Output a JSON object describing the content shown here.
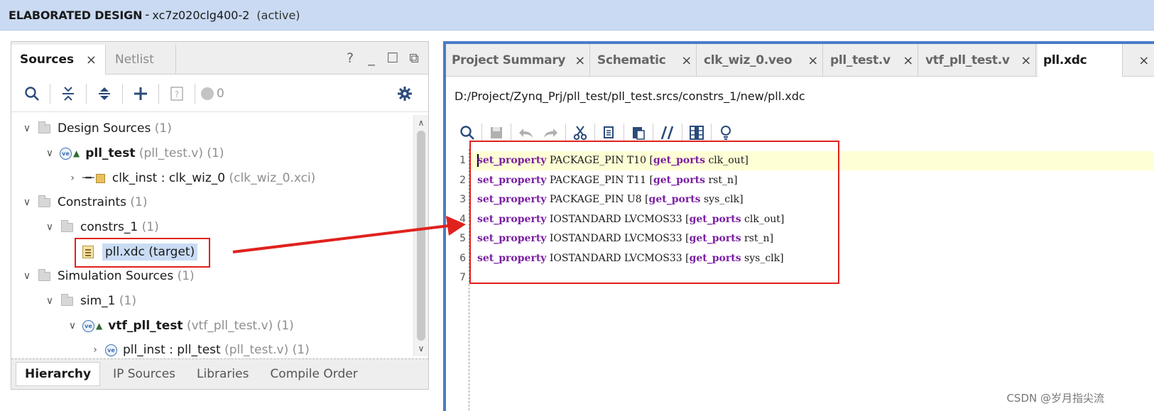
{
  "header": {
    "title": "ELABORATED DESIGN",
    "separator": "-",
    "part": "xc7z020clg400-2",
    "state": "(active)"
  },
  "sources_panel": {
    "tabs": [
      {
        "label": "Sources",
        "close": "×"
      },
      {
        "label": "Netlist"
      }
    ],
    "window_controls": [
      "?",
      "_",
      "☐",
      "⧉"
    ],
    "toolbar": {
      "count": "0",
      "icons": [
        "search-icon",
        "collapse-all-icon",
        "expand-all-icon",
        "add-icon",
        "properties-icon",
        "status-dot-icon",
        "gear-icon"
      ]
    },
    "tree": [
      {
        "label": "Design Sources",
        "count": "(1)"
      },
      {
        "label": "pll_test",
        "file": "(pll_test.v)",
        "count": "(1)"
      },
      {
        "label": "clk_inst : clk_wiz_0",
        "file": "(clk_wiz_0.xci)"
      },
      {
        "label": "Constraints",
        "count": "(1)"
      },
      {
        "label": "constrs_1",
        "count": "(1)"
      },
      {
        "label": "pll.xdc (target)"
      },
      {
        "label": "Simulation Sources",
        "count": "(1)"
      },
      {
        "label": "sim_1",
        "count": "(1)"
      },
      {
        "label": "vtf_pll_test",
        "file": "(vtf_pll_test.v)",
        "count": "(1)"
      },
      {
        "label": "pll_inst : pll_test",
        "file": "(pll_test.v)",
        "count": "(1)"
      }
    ],
    "bottom_tabs": [
      "Hierarchy",
      "IP Sources",
      "Libraries",
      "Compile Order"
    ]
  },
  "editor": {
    "tabs": [
      {
        "label": "Project Summary",
        "close": "×"
      },
      {
        "label": "Schematic",
        "close": "×"
      },
      {
        "label": "clk_wiz_0.veo",
        "close": "×"
      },
      {
        "label": "pll_test.v",
        "close": "×"
      },
      {
        "label": "vtf_pll_test.v",
        "close": "×"
      },
      {
        "label": "pll.xdc",
        "close": "×"
      }
    ],
    "file_path": "D:/Project/Zynq_Prj/pll_test/pll_test.srcs/constrs_1/new/pll.xdc",
    "line_numbers": [
      "1",
      "2",
      "3",
      "4",
      "5",
      "6",
      "7"
    ],
    "lines": [
      {
        "cmd": "set_property",
        "args": "PACKAGE_PIN T10",
        "open": "[",
        "sub": "get_ports",
        "port": "clk_out",
        "close": "]"
      },
      {
        "cmd": "set_property",
        "args": "PACKAGE_PIN T11",
        "open": "[",
        "sub": "get_ports",
        "port": "rst_n",
        "close": "]"
      },
      {
        "cmd": "set_property",
        "args": "PACKAGE_PIN U8",
        "open": "[",
        "sub": "get_ports",
        "port": "sys_clk",
        "close": "]"
      },
      {
        "cmd": "set_property",
        "args": "IOSTANDARD LVCMOS33",
        "open": "[",
        "sub": "get_ports",
        "port": "clk_out",
        "close": "]"
      },
      {
        "cmd": "set_property",
        "args": "IOSTANDARD LVCMOS33",
        "open": "[",
        "sub": "get_ports",
        "port": "rst_n",
        "close": "]"
      },
      {
        "cmd": "set_property",
        "args": "IOSTANDARD LVCMOS33",
        "open": "[",
        "sub": "get_ports",
        "port": "sys_clk",
        "close": "]"
      }
    ]
  },
  "watermark": "CSDN @岁月指尖流",
  "colors": {
    "header_bg": "#c9daf2",
    "keyword": "#7a1fa2",
    "annotation": "#e0221e",
    "active_pane_border": "#4a7cc7",
    "line_highlight": "#ffffd6"
  }
}
